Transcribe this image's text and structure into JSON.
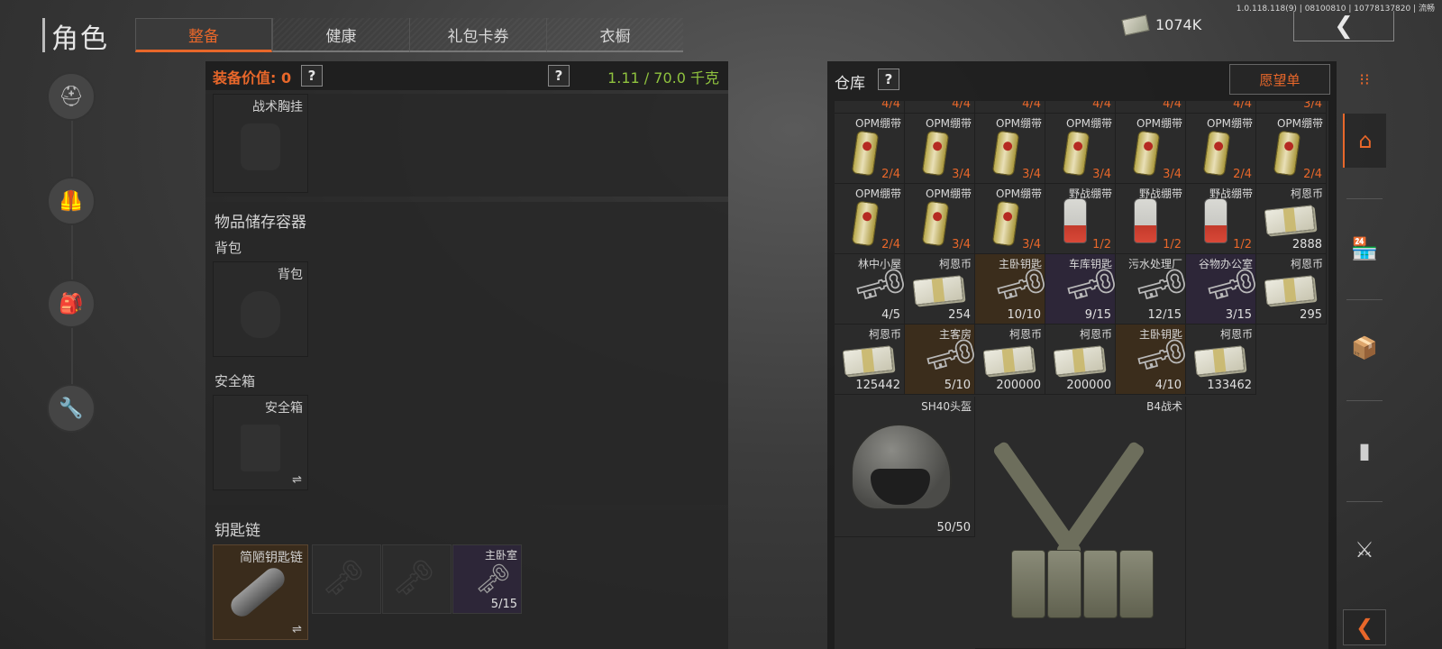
{
  "version": "1.0.118.118(9) | 08100810 | 10778137820 | 流畅",
  "title": "角色",
  "tabs": [
    {
      "label": "整备",
      "active": true
    },
    {
      "label": "健康",
      "active": false
    },
    {
      "label": "礼包卡券",
      "active": false
    },
    {
      "label": "衣橱",
      "active": false
    }
  ],
  "money": "1074K",
  "back_icon": "chevron-left-icon",
  "accent_color": "#e8672a",
  "weight_color": "#8fc23e",
  "left_rail": [
    "helmet-icon",
    "vest-icon",
    "backpack-icon",
    "wrench-icon"
  ],
  "equipment": {
    "value_label": "装备价值: 0",
    "help": "?",
    "weight": "1.11 / 70.0 千克",
    "chest_rig_slot": "战术胸挂",
    "storage_title": "物品储存容器",
    "backpack_label": "背包",
    "backpack_slot": "背包",
    "safe_label": "安全箱",
    "safe_slot": "安全箱",
    "swap": "⇌",
    "keychain_title": "钥匙链",
    "keychain_item": "简陋钥匙链",
    "key_slot_name": "主卧室",
    "key_slot_count": "5/15"
  },
  "stash": {
    "title": "仓库",
    "help": "?",
    "wishlist": "愿望单",
    "top_partial_counts": [
      "4/4",
      "4/4",
      "4/4",
      "4/4",
      "4/4",
      "4/4",
      "3/4"
    ],
    "rows": [
      [
        {
          "name": "OPM绷带",
          "count": "2/4",
          "type": "bandage"
        },
        {
          "name": "OPM绷带",
          "count": "3/4",
          "type": "bandage"
        },
        {
          "name": "OPM绷带",
          "count": "3/4",
          "type": "bandage"
        },
        {
          "name": "OPM绷带",
          "count": "3/4",
          "type": "bandage"
        },
        {
          "name": "OPM绷带",
          "count": "3/4",
          "type": "bandage"
        },
        {
          "name": "OPM绷带",
          "count": "2/4",
          "type": "bandage"
        },
        {
          "name": "OPM绷带",
          "count": "2/4",
          "type": "bandage"
        }
      ],
      [
        {
          "name": "OPM绷带",
          "count": "2/4",
          "type": "bandage"
        },
        {
          "name": "OPM绷带",
          "count": "3/4",
          "type": "bandage"
        },
        {
          "name": "OPM绷带",
          "count": "3/4",
          "type": "bandage"
        },
        {
          "name": "野战绷带",
          "count": "1/2",
          "type": "field"
        },
        {
          "name": "野战绷带",
          "count": "1/2",
          "type": "field"
        },
        {
          "name": "野战绷带",
          "count": "1/2",
          "type": "field"
        },
        {
          "name": "柯恩币",
          "count": "2888",
          "type": "cash"
        }
      ],
      [
        {
          "name": "林中小屋",
          "count": "4/5",
          "type": "key"
        },
        {
          "name": "柯恩币",
          "count": "254",
          "type": "cash"
        },
        {
          "name": "主卧钥匙",
          "count": "10/10",
          "type": "key",
          "bg": "#3b2d1c"
        },
        {
          "name": "车库钥匙",
          "count": "9/15",
          "type": "key",
          "bg": "#2d2638"
        },
        {
          "name": "污水处理厂",
          "count": "12/15",
          "type": "key"
        },
        {
          "name": "谷物办公室",
          "count": "3/15",
          "type": "key",
          "bg": "#2d2638"
        },
        {
          "name": "柯恩币",
          "count": "295",
          "type": "cash"
        }
      ],
      [
        {
          "name": "柯恩币",
          "count": "125442",
          "type": "cash"
        },
        {
          "name": "主客房",
          "count": "5/10",
          "type": "key",
          "bg": "#3b2d1c"
        },
        {
          "name": "柯恩币",
          "count": "200000",
          "type": "cash"
        },
        {
          "name": "柯恩币",
          "count": "200000",
          "type": "cash"
        },
        {
          "name": "主卧钥匙",
          "count": "4/10",
          "type": "key",
          "bg": "#3b2d1c"
        },
        {
          "name": "柯恩币",
          "count": "133462",
          "type": "cash"
        }
      ]
    ],
    "helmet": {
      "name": "SH40头盔",
      "count": "50/50"
    },
    "vest": {
      "name": "B4战术"
    }
  },
  "right_rail": [
    "grid-icon",
    "home-icon",
    "shop-icon",
    "box-icon",
    "ammo-icon",
    "rifle-icon"
  ],
  "collapse_icon": "chevron-left-icon"
}
